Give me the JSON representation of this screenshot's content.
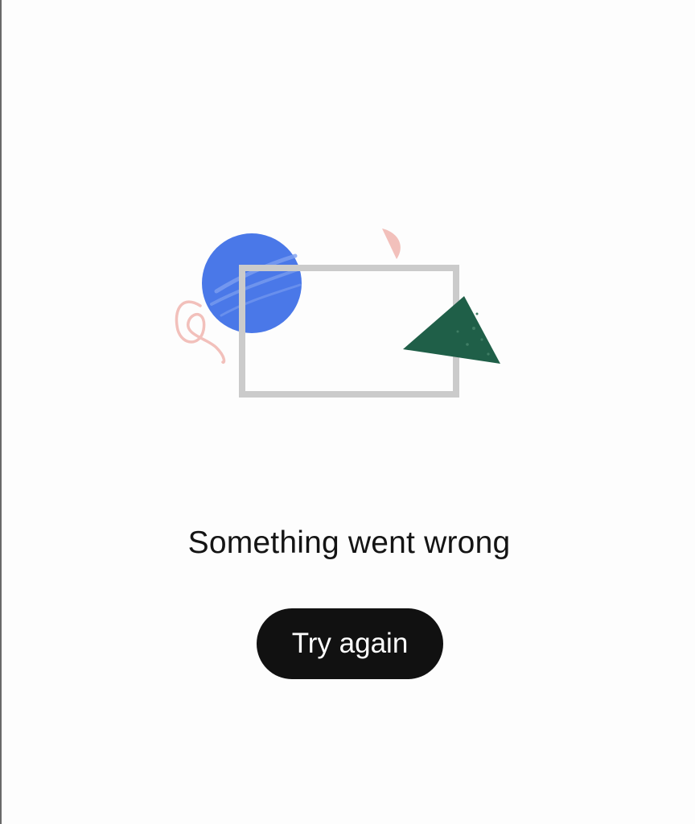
{
  "error_state": {
    "illustration_icon": "broken-image-illustration",
    "title": "Something went wrong",
    "retry_label": "Try again"
  },
  "colors": {
    "background": "#fdfdfd",
    "title_text": "#141414",
    "button_background": "#111111",
    "button_text": "#ffffff",
    "illustration_blue": "#4a78e8",
    "illustration_gray": "#cbcbcb",
    "illustration_green": "#1f5f48",
    "illustration_pink": "#f2c0bb"
  }
}
